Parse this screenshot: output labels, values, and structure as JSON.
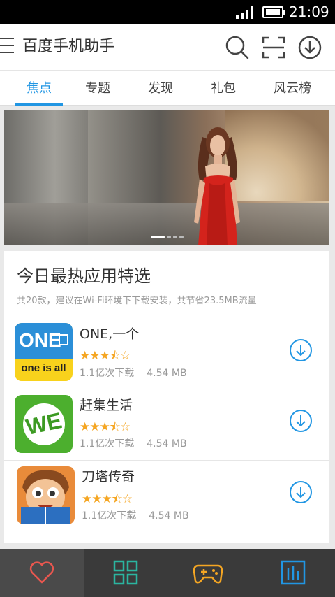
{
  "status_bar": {
    "time": "21:09"
  },
  "header": {
    "title": "百度手机助手",
    "icons": [
      "menu-icon",
      "search-icon",
      "scan-icon",
      "download-icon"
    ]
  },
  "tabs": [
    {
      "label": "焦点",
      "active": true
    },
    {
      "label": "专题",
      "active": false
    },
    {
      "label": "发现",
      "active": false
    },
    {
      "label": "礼包",
      "active": false
    },
    {
      "label": "风云榜",
      "active": false
    }
  ],
  "banner": {
    "slide_count": 4,
    "active_slide": 1
  },
  "section": {
    "title": "今日最热应用特选",
    "subtitle": "共20款，建议在Wi-Fi环境下下载安装，共节省23.5MB流量"
  },
  "apps": [
    {
      "name": "ONE,一个",
      "rating": 3.5,
      "stars": "★★★⯪☆",
      "downloads": "1.1亿次下载",
      "size": "4.54 MB",
      "icon_text_top": "ONE",
      "icon_text_bottom": "one is all"
    },
    {
      "name": "赶集生活",
      "rating": 3.5,
      "stars": "★★★⯪☆",
      "downloads": "1.1亿次下载",
      "size": "4.54 MB",
      "icon_text_top": "WE"
    },
    {
      "name": "刀塔传奇",
      "rating": 3.5,
      "stars": "★★★⯪☆",
      "downloads": "1.1亿次下载",
      "size": "4.54 MB"
    }
  ],
  "bottom_nav": [
    {
      "icon": "heart-icon",
      "color": "#e8574f",
      "active": true
    },
    {
      "icon": "grid-icon",
      "color": "#2bb5a0",
      "active": false
    },
    {
      "icon": "gamepad-icon",
      "color": "#f5a623",
      "active": false
    },
    {
      "icon": "chart-icon",
      "color": "#2196e3",
      "active": false
    }
  ],
  "colors": {
    "accent": "#2196e3",
    "star": "#f5a623",
    "nav_bg": "#3a3a3a"
  }
}
